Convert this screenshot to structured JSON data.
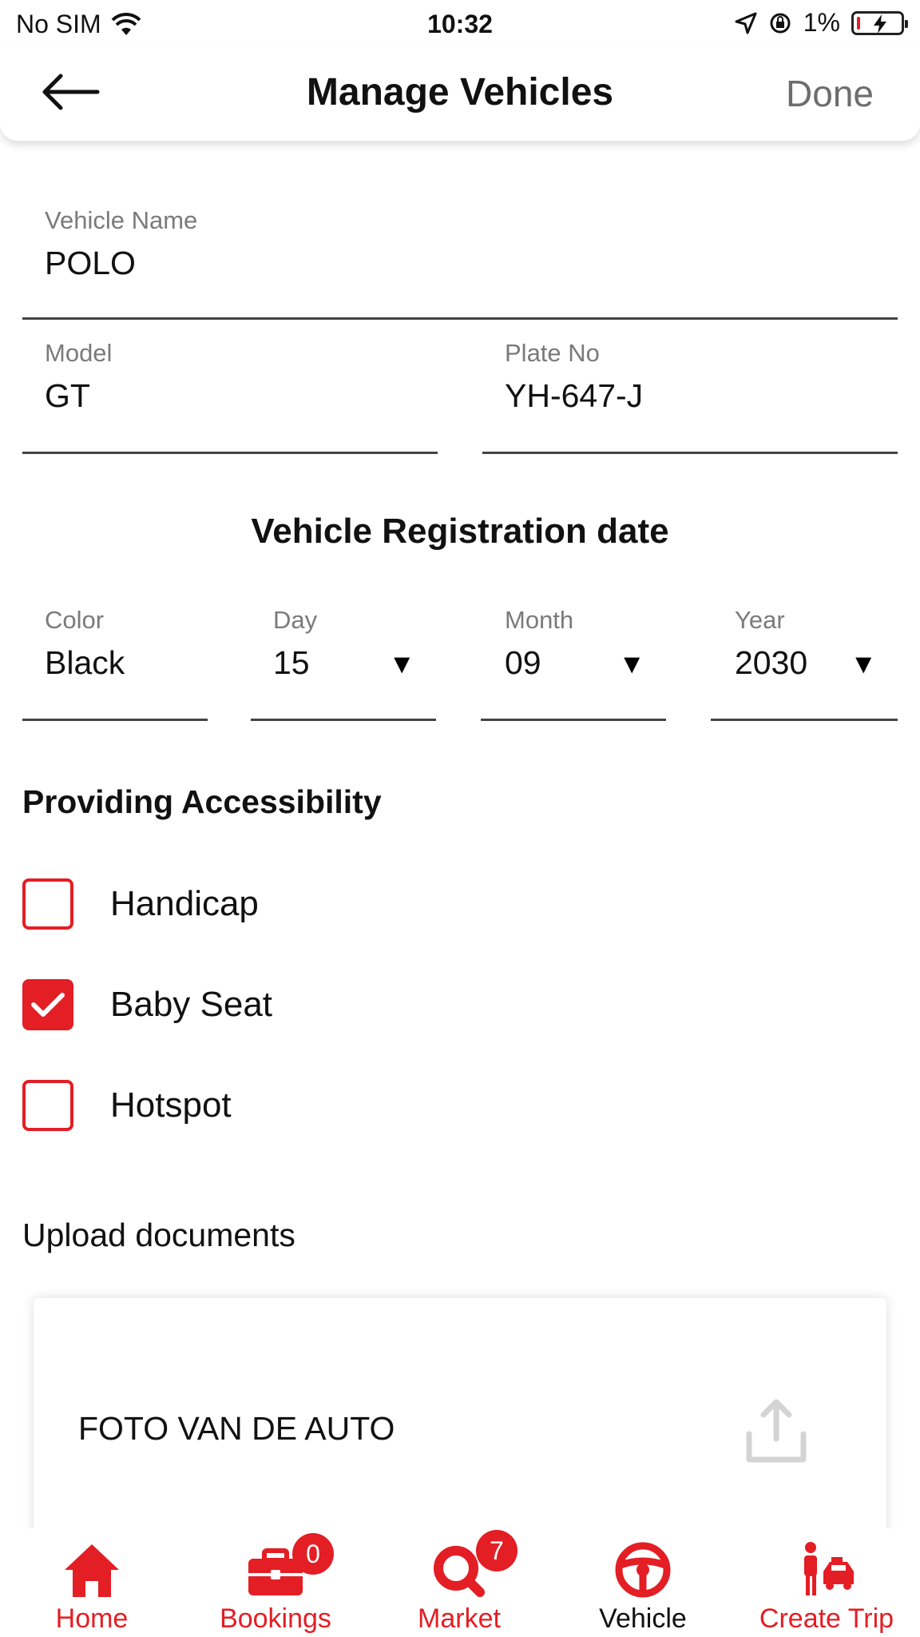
{
  "status_bar": {
    "carrier": "No SIM",
    "time": "10:32",
    "battery": "1%"
  },
  "header": {
    "title": "Manage Vehicles",
    "done_label": "Done"
  },
  "form": {
    "vehicle_name": {
      "label": "Vehicle Name",
      "value": "POLO"
    },
    "model": {
      "label": "Model",
      "value": "GT"
    },
    "plate_no": {
      "label": "Plate No",
      "value": "YH-647-J"
    },
    "registration_title": "Vehicle Registration date",
    "color": {
      "label": "Color",
      "value": "Black"
    },
    "day": {
      "label": "Day",
      "value": "15"
    },
    "month": {
      "label": "Month",
      "value": "09"
    },
    "year": {
      "label": "Year",
      "value": "2030"
    },
    "dropdown_caret": "▼"
  },
  "accessibility": {
    "title": "Providing Accessibility",
    "options": [
      {
        "label": "Handicap",
        "checked": false
      },
      {
        "label": "Baby Seat",
        "checked": true
      },
      {
        "label": "Hotspot",
        "checked": false
      }
    ]
  },
  "upload": {
    "title": "Upload documents",
    "item_label": "FOTO VAN DE AUTO",
    "icon": "upload-icon"
  },
  "bottom_nav": {
    "accent_color": "#e31e24",
    "items": [
      {
        "label": "Home",
        "icon": "home-icon"
      },
      {
        "label": "Bookings",
        "icon": "briefcase-icon",
        "badge": "0"
      },
      {
        "label": "Market",
        "icon": "market-search-icon",
        "badge": "7"
      },
      {
        "label": "Vehicle",
        "icon": "steering-wheel-icon",
        "active": true
      },
      {
        "label": "Create Trip",
        "icon": "traveler-car-icon"
      }
    ]
  }
}
